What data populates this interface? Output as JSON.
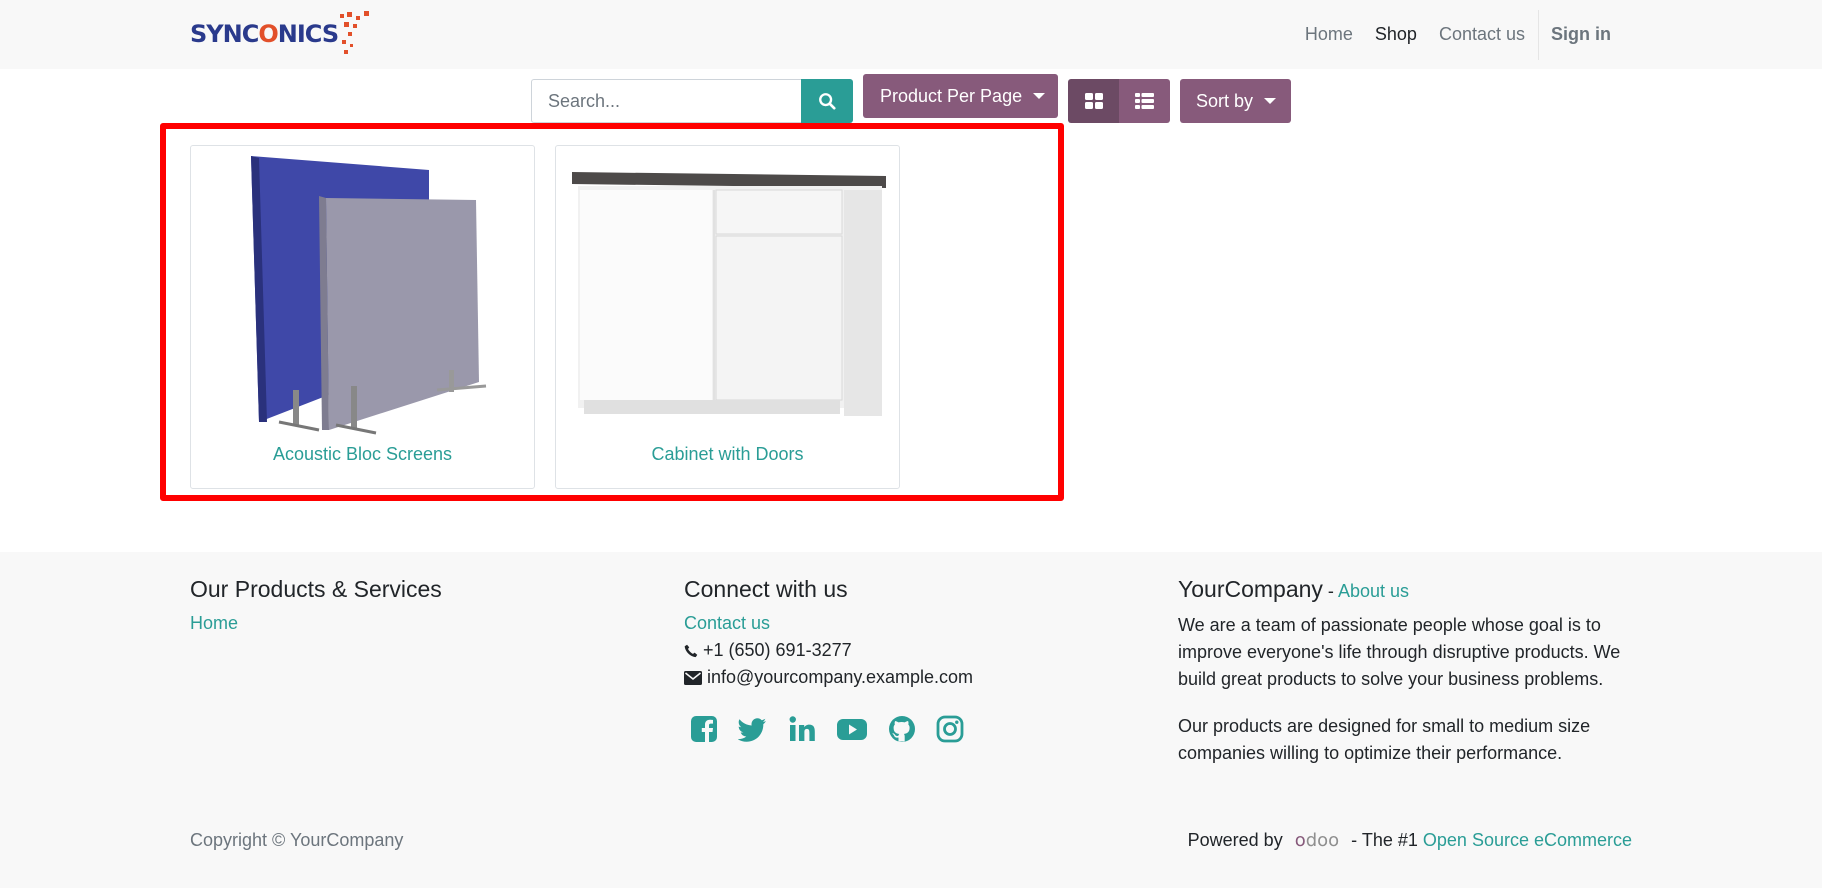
{
  "header": {
    "brand": {
      "part1": "SYNC",
      "part2": "O",
      "part3": "NICS"
    },
    "nav": [
      {
        "label": "Home",
        "active": false
      },
      {
        "label": "Shop",
        "active": true
      },
      {
        "label": "Contact us",
        "active": false
      }
    ],
    "sign_in": "Sign in"
  },
  "toolbar": {
    "search_placeholder": "Search...",
    "search_value": "",
    "per_page_label": "Product Per Page",
    "sort_label": "Sort by",
    "view_mode": "grid"
  },
  "products": [
    {
      "name": "Acoustic Bloc Screens",
      "image": "acoustic-screens"
    },
    {
      "name": "Cabinet with Doors",
      "image": "cabinet"
    }
  ],
  "footer": {
    "col1": {
      "heading": "Our Products & Services",
      "links": [
        "Home"
      ]
    },
    "col2": {
      "heading": "Connect with us",
      "contact_link": "Contact us",
      "phone": "+1 (650) 691-3277",
      "email": "info@yourcompany.example.com",
      "socials": [
        "facebook-icon",
        "twitter-icon",
        "linkedin-icon",
        "youtube-icon",
        "github-icon",
        "instagram-icon"
      ]
    },
    "col3": {
      "company": "YourCompany",
      "separator": " - ",
      "about_link": "About us",
      "paragraph1": "We are a team of passionate people whose goal is to improve everyone's life through disruptive products. We build great products to solve your business problems.",
      "paragraph2": "Our products are designed for small to medium size companies willing to optimize their performance."
    },
    "copyright": "Copyright © YourCompany",
    "powered_by": "Powered by",
    "odoo": {
      "o": "o",
      "rest": "doo"
    },
    "tagline": "- The #1",
    "tagline_link": "Open Source eCommerce"
  },
  "colors": {
    "primary": "#875a7b",
    "secondary": "#2a9d96",
    "highlight": "#ff0000",
    "brand_blue": "#2a3a8c",
    "brand_orange": "#e2502a"
  }
}
